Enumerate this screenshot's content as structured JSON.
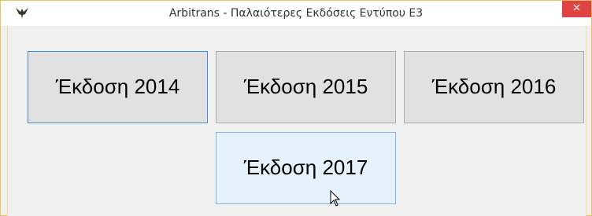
{
  "window": {
    "title": "Arbitrans - Παλαιότερες Εκδόσεις Εντύπου Ε3",
    "close_label": "×"
  },
  "buttons": [
    {
      "label": "Έκδοση 2014"
    },
    {
      "label": "Έκδοση 2015"
    },
    {
      "label": "Έκδοση 2016"
    },
    {
      "label": "Έκδοση 2017"
    }
  ],
  "icons": {
    "app": "eagle-icon",
    "close": "close-icon",
    "cursor": "mouse-cursor-icon"
  },
  "colors": {
    "focus_border": "#3c8cd6",
    "hover_background": "#e5f1fb",
    "close_red": "#e04343"
  }
}
